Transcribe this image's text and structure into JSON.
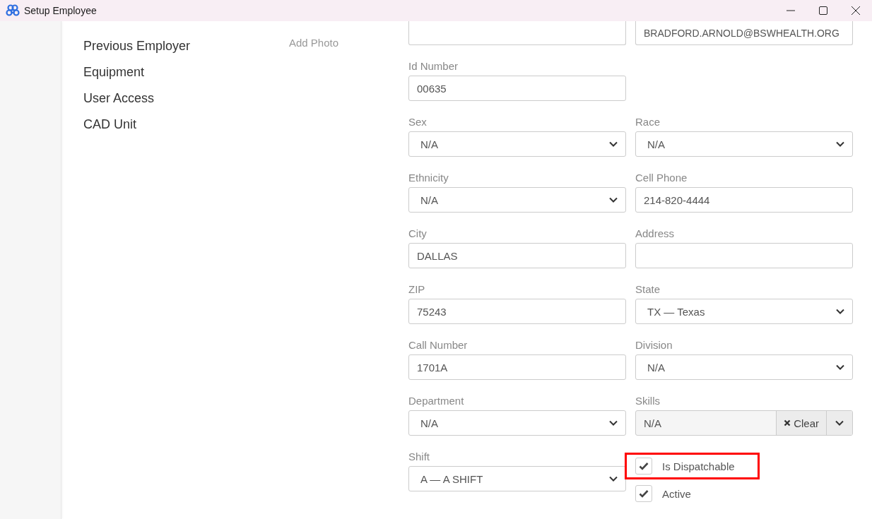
{
  "window": {
    "title": "Setup Employee"
  },
  "nav": {
    "items": [
      {
        "label": "Previous Employer"
      },
      {
        "label": "Equipment"
      },
      {
        "label": "User Access"
      },
      {
        "label": "CAD Unit"
      }
    ]
  },
  "photo": {
    "action": "Add Photo"
  },
  "form": {
    "rows": [
      [
        {
          "kind": "input"
        },
        {
          "kind": "input",
          "value": "BRADFORD.ARNOLD@BSWHEALTH.ORG"
        }
      ],
      [
        {
          "kind": "input",
          "label": "Id Number",
          "value": "00635"
        }
      ],
      [
        {
          "kind": "select",
          "label": "Sex",
          "value": "N/A"
        },
        {
          "kind": "select",
          "label": "Race",
          "value": "N/A"
        }
      ],
      [
        {
          "kind": "select",
          "label": "Ethnicity",
          "value": "N/A"
        },
        {
          "kind": "input",
          "label": "Cell Phone",
          "value": "214-820-4444"
        }
      ],
      [
        {
          "kind": "input",
          "label": "City",
          "value": "DALLAS"
        },
        {
          "kind": "input",
          "label": "Address"
        }
      ],
      [
        {
          "kind": "input",
          "label": "ZIP",
          "value": "75243"
        },
        {
          "kind": "select",
          "label": "State",
          "value": "TX — Texas"
        }
      ],
      [
        {
          "kind": "input",
          "label": "Call Number",
          "value": "1701A"
        },
        {
          "kind": "select",
          "label": "Division",
          "value": "N/A"
        }
      ],
      [
        {
          "kind": "select",
          "label": "Department",
          "value": "N/A"
        },
        {
          "kind": "multiselect",
          "label": "Skills",
          "value": "N/A",
          "clear": "Clear"
        }
      ],
      [
        {
          "kind": "select",
          "label": "Shift",
          "value": "A — A SHIFT"
        },
        {
          "kind": "checks",
          "items": [
            {
              "label": "Is Dispatchable",
              "checked": true,
              "highlighted": true
            },
            {
              "label": "Active",
              "checked": true,
              "highlighted": false
            }
          ]
        }
      ]
    ]
  }
}
